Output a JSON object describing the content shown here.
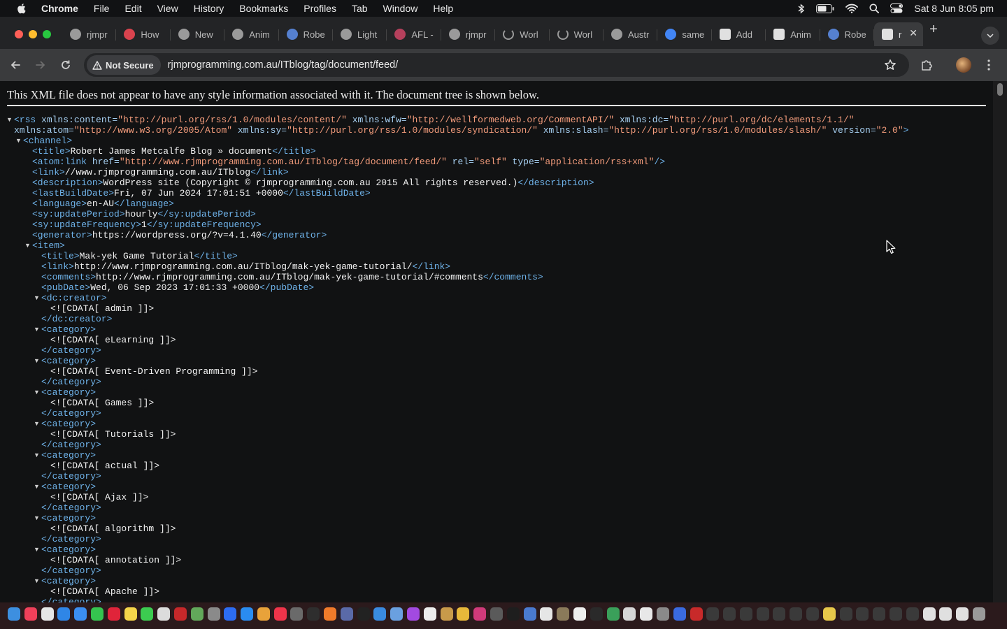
{
  "menubar": {
    "items": [
      "Chrome",
      "File",
      "Edit",
      "View",
      "History",
      "Bookmarks",
      "Profiles",
      "Tab",
      "Window",
      "Help"
    ],
    "clock": "Sat 8 Jun  8:05 pm"
  },
  "tabs": [
    {
      "label": "rjmpr",
      "icon": "rjm-favicon",
      "color": "#9a9a9a"
    },
    {
      "label": "How",
      "icon": "red-circle-favicon",
      "color": "#d9434e"
    },
    {
      "label": "New",
      "icon": "rjm-favicon",
      "color": "#9a9a9a"
    },
    {
      "label": "Anim",
      "icon": "elephant-favicon",
      "color": "#9a9a9a"
    },
    {
      "label": "Robe",
      "icon": "wordpress-favicon",
      "color": "#5580d0"
    },
    {
      "label": "Light",
      "icon": "swirl-favicon",
      "color": "#9a9a9a"
    },
    {
      "label": "AFL -",
      "icon": "afl-favicon",
      "color": "#b5405c"
    },
    {
      "label": "rjmpr",
      "icon": "rjm-favicon",
      "color": "#9a9a9a"
    },
    {
      "label": "Worl",
      "icon": "loading-favicon",
      "color": "#9a9a9a"
    },
    {
      "label": "Worl",
      "icon": "loading-favicon",
      "color": "#9a9a9a"
    },
    {
      "label": "Austr",
      "icon": "austr-favicon",
      "color": "#9a9a9a"
    },
    {
      "label": "same",
      "icon": "google-favicon",
      "color": "#4285f4"
    },
    {
      "label": "Add",
      "icon": "image-favicon",
      "color": "#e0e0e0"
    },
    {
      "label": "Anim",
      "icon": "image-favicon",
      "color": "#e0e0e0"
    },
    {
      "label": "Robe",
      "icon": "wordpress-favicon",
      "color": "#5580d0"
    },
    {
      "label": "r",
      "icon": "image-favicon",
      "color": "#e0e0e0",
      "active": true
    }
  ],
  "toolbar": {
    "security_label": "Not Secure",
    "url": "rjmprogramming.com.au/ITblog/tag/document/feed/"
  },
  "page": {
    "notice": "This XML file does not appear to have any style information associated with it. The document tree is shown below."
  },
  "xml_lines": [
    {
      "indent": 20,
      "toggle": true,
      "segs": [
        [
          "tag",
          "<rss "
        ],
        [
          "an",
          "xmlns:content="
        ],
        [
          "av",
          "\"http://purl.org/rss/1.0/modules/content/\""
        ],
        [
          "an",
          " xmlns:wfw="
        ],
        [
          "av",
          "\"http://wellformedweb.org/CommentAPI/\""
        ],
        [
          "an",
          " xmlns:dc="
        ],
        [
          "av",
          "\"http://purl.org/dc/elements/1.1/\""
        ]
      ]
    },
    {
      "indent": 20,
      "segs": [
        [
          "an",
          "xmlns:atom="
        ],
        [
          "av",
          "\"http://www.w3.org/2005/Atom\""
        ],
        [
          "an",
          " xmlns:sy="
        ],
        [
          "av",
          "\"http://purl.org/rss/1.0/modules/syndication/\""
        ],
        [
          "an",
          " xmlns:slash="
        ],
        [
          "av",
          "\"http://purl.org/rss/1.0/modules/slash/\""
        ],
        [
          "an",
          " version="
        ],
        [
          "av",
          "\"2.0\""
        ],
        [
          "tag",
          ">"
        ]
      ]
    },
    {
      "indent": 33,
      "toggle": true,
      "segs": [
        [
          "tag",
          "<channel>"
        ]
      ]
    },
    {
      "indent": 46,
      "segs": [
        [
          "tag",
          "<title>"
        ],
        [
          "tx",
          "Robert James Metcalfe Blog » document"
        ],
        [
          "tag",
          "</title>"
        ]
      ]
    },
    {
      "indent": 46,
      "segs": [
        [
          "tag",
          "<atom:link "
        ],
        [
          "an",
          "href="
        ],
        [
          "av",
          "\"http://www.rjmprogramming.com.au/ITblog/tag/document/feed/\""
        ],
        [
          "an",
          " rel="
        ],
        [
          "av",
          "\"self\""
        ],
        [
          "an",
          " type="
        ],
        [
          "av",
          "\"application/rss+xml\""
        ],
        [
          "tag",
          "/>"
        ]
      ]
    },
    {
      "indent": 46,
      "segs": [
        [
          "tag",
          "<link>"
        ],
        [
          "tx",
          "//www.rjmprogramming.com.au/ITblog"
        ],
        [
          "tag",
          "</link>"
        ]
      ]
    },
    {
      "indent": 46,
      "segs": [
        [
          "tag",
          "<description>"
        ],
        [
          "tx",
          "WordPress site (Copyright © rjmprogramming.com.au 2015 All rights reserved.)"
        ],
        [
          "tag",
          "</description>"
        ]
      ]
    },
    {
      "indent": 46,
      "segs": [
        [
          "tag",
          "<lastBuildDate>"
        ],
        [
          "tx",
          "Fri, 07 Jun 2024 17:01:51 +0000"
        ],
        [
          "tag",
          "</lastBuildDate>"
        ]
      ]
    },
    {
      "indent": 46,
      "segs": [
        [
          "tag",
          "<language>"
        ],
        [
          "tx",
          "en-AU"
        ],
        [
          "tag",
          "</language>"
        ]
      ]
    },
    {
      "indent": 46,
      "segs": [
        [
          "tag",
          "<sy:updatePeriod>"
        ],
        [
          "tx",
          "hourly"
        ],
        [
          "tag",
          "</sy:updatePeriod>"
        ]
      ]
    },
    {
      "indent": 46,
      "segs": [
        [
          "tag",
          "<sy:updateFrequency>"
        ],
        [
          "tx",
          "1"
        ],
        [
          "tag",
          "</sy:updateFrequency>"
        ]
      ]
    },
    {
      "indent": 46,
      "segs": [
        [
          "tag",
          "<generator>"
        ],
        [
          "tx",
          "https://wordpress.org/?v=4.1.40"
        ],
        [
          "tag",
          "</generator>"
        ]
      ]
    },
    {
      "indent": 46,
      "toggle": true,
      "segs": [
        [
          "tag",
          "<item>"
        ]
      ]
    },
    {
      "indent": 59,
      "segs": [
        [
          "tag",
          "<title>"
        ],
        [
          "tx",
          "Mak-yek Game Tutorial"
        ],
        [
          "tag",
          "</title>"
        ]
      ]
    },
    {
      "indent": 59,
      "segs": [
        [
          "tag",
          "<link>"
        ],
        [
          "tx",
          "http://www.rjmprogramming.com.au/ITblog/mak-yek-game-tutorial/"
        ],
        [
          "tag",
          "</link>"
        ]
      ]
    },
    {
      "indent": 59,
      "segs": [
        [
          "tag",
          "<comments>"
        ],
        [
          "tx",
          "http://www.rjmprogramming.com.au/ITblog/mak-yek-game-tutorial/#comments"
        ],
        [
          "tag",
          "</comments>"
        ]
      ]
    },
    {
      "indent": 59,
      "segs": [
        [
          "tag",
          "<pubDate>"
        ],
        [
          "tx",
          "Wed, 06 Sep 2023 17:01:33 +0000"
        ],
        [
          "tag",
          "</pubDate>"
        ]
      ]
    },
    {
      "indent": 59,
      "toggle": true,
      "segs": [
        [
          "tag",
          "<dc:creator>"
        ]
      ]
    },
    {
      "indent": 72,
      "segs": [
        [
          "tx",
          "<![CDATA[ admin ]]>"
        ]
      ]
    },
    {
      "indent": 59,
      "segs": [
        [
          "tag",
          "</dc:creator>"
        ]
      ]
    },
    {
      "indent": 59,
      "toggle": true,
      "segs": [
        [
          "tag",
          "<category>"
        ]
      ]
    },
    {
      "indent": 72,
      "segs": [
        [
          "tx",
          "<![CDATA[ eLearning ]]>"
        ]
      ]
    },
    {
      "indent": 59,
      "segs": [
        [
          "tag",
          "</category>"
        ]
      ]
    },
    {
      "indent": 59,
      "toggle": true,
      "segs": [
        [
          "tag",
          "<category>"
        ]
      ]
    },
    {
      "indent": 72,
      "segs": [
        [
          "tx",
          "<![CDATA[ Event-Driven Programming ]]>"
        ]
      ]
    },
    {
      "indent": 59,
      "segs": [
        [
          "tag",
          "</category>"
        ]
      ]
    },
    {
      "indent": 59,
      "toggle": true,
      "segs": [
        [
          "tag",
          "<category>"
        ]
      ]
    },
    {
      "indent": 72,
      "segs": [
        [
          "tx",
          "<![CDATA[ Games ]]>"
        ]
      ]
    },
    {
      "indent": 59,
      "segs": [
        [
          "tag",
          "</category>"
        ]
      ]
    },
    {
      "indent": 59,
      "toggle": true,
      "segs": [
        [
          "tag",
          "<category>"
        ]
      ]
    },
    {
      "indent": 72,
      "segs": [
        [
          "tx",
          "<![CDATA[ Tutorials ]]>"
        ]
      ]
    },
    {
      "indent": 59,
      "segs": [
        [
          "tag",
          "</category>"
        ]
      ]
    },
    {
      "indent": 59,
      "toggle": true,
      "segs": [
        [
          "tag",
          "<category>"
        ]
      ]
    },
    {
      "indent": 72,
      "segs": [
        [
          "tx",
          "<![CDATA[ actual ]]>"
        ]
      ]
    },
    {
      "indent": 59,
      "segs": [
        [
          "tag",
          "</category>"
        ]
      ]
    },
    {
      "indent": 59,
      "toggle": true,
      "segs": [
        [
          "tag",
          "<category>"
        ]
      ]
    },
    {
      "indent": 72,
      "segs": [
        [
          "tx",
          "<![CDATA[ Ajax ]]>"
        ]
      ]
    },
    {
      "indent": 59,
      "segs": [
        [
          "tag",
          "</category>"
        ]
      ]
    },
    {
      "indent": 59,
      "toggle": true,
      "segs": [
        [
          "tag",
          "<category>"
        ]
      ]
    },
    {
      "indent": 72,
      "segs": [
        [
          "tx",
          "<![CDATA[ algorithm ]]>"
        ]
      ]
    },
    {
      "indent": 59,
      "segs": [
        [
          "tag",
          "</category>"
        ]
      ]
    },
    {
      "indent": 59,
      "toggle": true,
      "segs": [
        [
          "tag",
          "<category>"
        ]
      ]
    },
    {
      "indent": 72,
      "segs": [
        [
          "tx",
          "<![CDATA[ annotation ]]>"
        ]
      ]
    },
    {
      "indent": 59,
      "segs": [
        [
          "tag",
          "</category>"
        ]
      ]
    },
    {
      "indent": 59,
      "toggle": true,
      "segs": [
        [
          "tag",
          "<category>"
        ]
      ]
    },
    {
      "indent": 72,
      "segs": [
        [
          "tx",
          "<![CDATA[ Apache ]]>"
        ]
      ]
    },
    {
      "indent": 59,
      "segs": [
        [
          "tag",
          "</category>"
        ]
      ]
    }
  ],
  "dock": {
    "icons": [
      {
        "name": "finder",
        "color": "#3d8fe0"
      },
      {
        "name": "music",
        "color": "#f0405a"
      },
      {
        "name": "launchpad",
        "color": "#e6e6e6"
      },
      {
        "name": "safari",
        "color": "#2f86e6"
      },
      {
        "name": "mail",
        "color": "#3b8ef0"
      },
      {
        "name": "facetime",
        "color": "#35c34f"
      },
      {
        "name": "opera",
        "color": "#e0243a"
      },
      {
        "name": "notes",
        "color": "#f5d44a"
      },
      {
        "name": "messages",
        "color": "#3ccb50"
      },
      {
        "name": "textedit",
        "color": "#dcdcdc"
      },
      {
        "name": "filezilla",
        "color": "#c7282a"
      },
      {
        "name": "photo-tool",
        "color": "#62a85a"
      },
      {
        "name": "games",
        "color": "#8a8a8a"
      },
      {
        "name": "zoom",
        "color": "#2d6cf2"
      },
      {
        "name": "app-store",
        "color": "#2a8cf0"
      },
      {
        "name": "photos",
        "color": "#e8a23a"
      },
      {
        "name": "news",
        "color": "#f0344a"
      },
      {
        "name": "tool",
        "color": "#6a6a6a"
      },
      {
        "name": "terminal-dark",
        "color": "#2e2e2e"
      },
      {
        "name": "firefox",
        "color": "#f07a2a"
      },
      {
        "name": "bbedit",
        "color": "#5a6aa8"
      },
      {
        "name": "apple-tv",
        "color": "#222222"
      },
      {
        "name": "xcode",
        "color": "#3a8ae0"
      },
      {
        "name": "preview",
        "color": "#6aa0e0"
      },
      {
        "name": "podcasts",
        "color": "#a24ae0"
      },
      {
        "name": "calendar",
        "color": "#ededed"
      },
      {
        "name": "stickies",
        "color": "#c89a4a"
      },
      {
        "name": "chrome",
        "color": "#e8b83a"
      },
      {
        "name": "intellij",
        "color": "#d03a7a"
      },
      {
        "name": "calculator",
        "color": "#5a5a5a"
      },
      {
        "name": "terminal",
        "color": "#1e1e1e"
      },
      {
        "name": "quicktime",
        "color": "#4a7ad0"
      },
      {
        "name": "document",
        "color": "#e6e6e6"
      },
      {
        "name": "gimp",
        "color": "#8a7a5a"
      },
      {
        "name": "github",
        "color": "#eeeeee"
      },
      {
        "name": "console",
        "color": "#2a2a2a"
      },
      {
        "name": "triangle-app",
        "color": "#3aa05a"
      },
      {
        "name": "gpg",
        "color": "#d6d6d6"
      },
      {
        "name": "script-editor",
        "color": "#e8e8e8"
      },
      {
        "name": "settings",
        "color": "#8a8a8a"
      },
      {
        "name": "xquartz",
        "color": "#3a6ae0"
      },
      {
        "name": "red-doc",
        "color": "#c82a2a"
      },
      {
        "name": "window-1",
        "color": "#3a3a3a"
      },
      {
        "name": "window-2",
        "color": "#3a3a3a"
      },
      {
        "name": "window-3",
        "color": "#3a3a3a"
      },
      {
        "name": "window-4",
        "color": "#3a3a3a"
      },
      {
        "name": "window-5",
        "color": "#3a3a3a"
      },
      {
        "name": "window-6",
        "color": "#3a3a3a"
      },
      {
        "name": "window-7",
        "color": "#3a3a3a"
      },
      {
        "name": "folder-yellow",
        "color": "#e8c84a"
      },
      {
        "name": "window-8",
        "color": "#3a3a3a"
      },
      {
        "name": "window-9",
        "color": "#3a3a3a"
      },
      {
        "name": "window-10",
        "color": "#3a3a3a"
      },
      {
        "name": "window-11",
        "color": "#3a3a3a"
      },
      {
        "name": "window-12",
        "color": "#3a3a3a"
      },
      {
        "name": "window-13",
        "color": "#e0e0e0"
      },
      {
        "name": "window-14",
        "color": "#e0e0e0"
      },
      {
        "name": "window-15",
        "color": "#e0e0e0"
      },
      {
        "name": "trash",
        "color": "#9a9a9a"
      }
    ]
  }
}
